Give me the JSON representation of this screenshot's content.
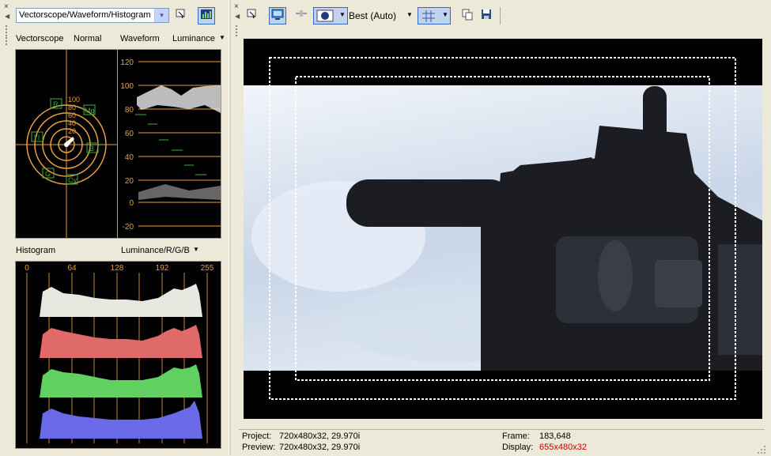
{
  "left_panel": {
    "scope_select": "Vectorscope/Waveform/Histogram",
    "vectorscope": {
      "title": "Vectorscope",
      "mode": "Normal",
      "rings": [
        "100",
        "80",
        "60",
        "40",
        "20"
      ],
      "targets": [
        "R",
        "Mg",
        "Yl",
        "B",
        "G",
        "Cy"
      ]
    },
    "waveform": {
      "title": "Waveform",
      "mode": "Luminance",
      "ticks": [
        "120",
        "100",
        "80",
        "60",
        "40",
        "20",
        "0",
        "-20"
      ]
    },
    "histogram": {
      "title": "Histogram",
      "mode": "Luminance/R/G/B",
      "ticks": [
        "0",
        "64",
        "128",
        "192",
        "255"
      ]
    }
  },
  "toolbar": {
    "quality": "Best (Auto)"
  },
  "status": {
    "project_label": "Project:",
    "project_value": "720x480x32, 29.970i",
    "preview_label": "Preview:",
    "preview_value": "720x480x32, 29.970i",
    "frame_label": "Frame:",
    "frame_value": "183,648",
    "display_label": "Display:",
    "display_value": "655x480x32"
  },
  "colors": {
    "accent": "#316ac5",
    "display_value": "#c00000",
    "graticule": "#e8a040"
  },
  "icons": [
    "close-icon",
    "scope-settings-icon",
    "scope-update-icon",
    "preview-props-icon",
    "monitor-icon",
    "split-screen-icon",
    "overlay-icon",
    "grid-icon",
    "copy-snapshot-icon",
    "save-snapshot-icon",
    "chevron-down-icon"
  ]
}
